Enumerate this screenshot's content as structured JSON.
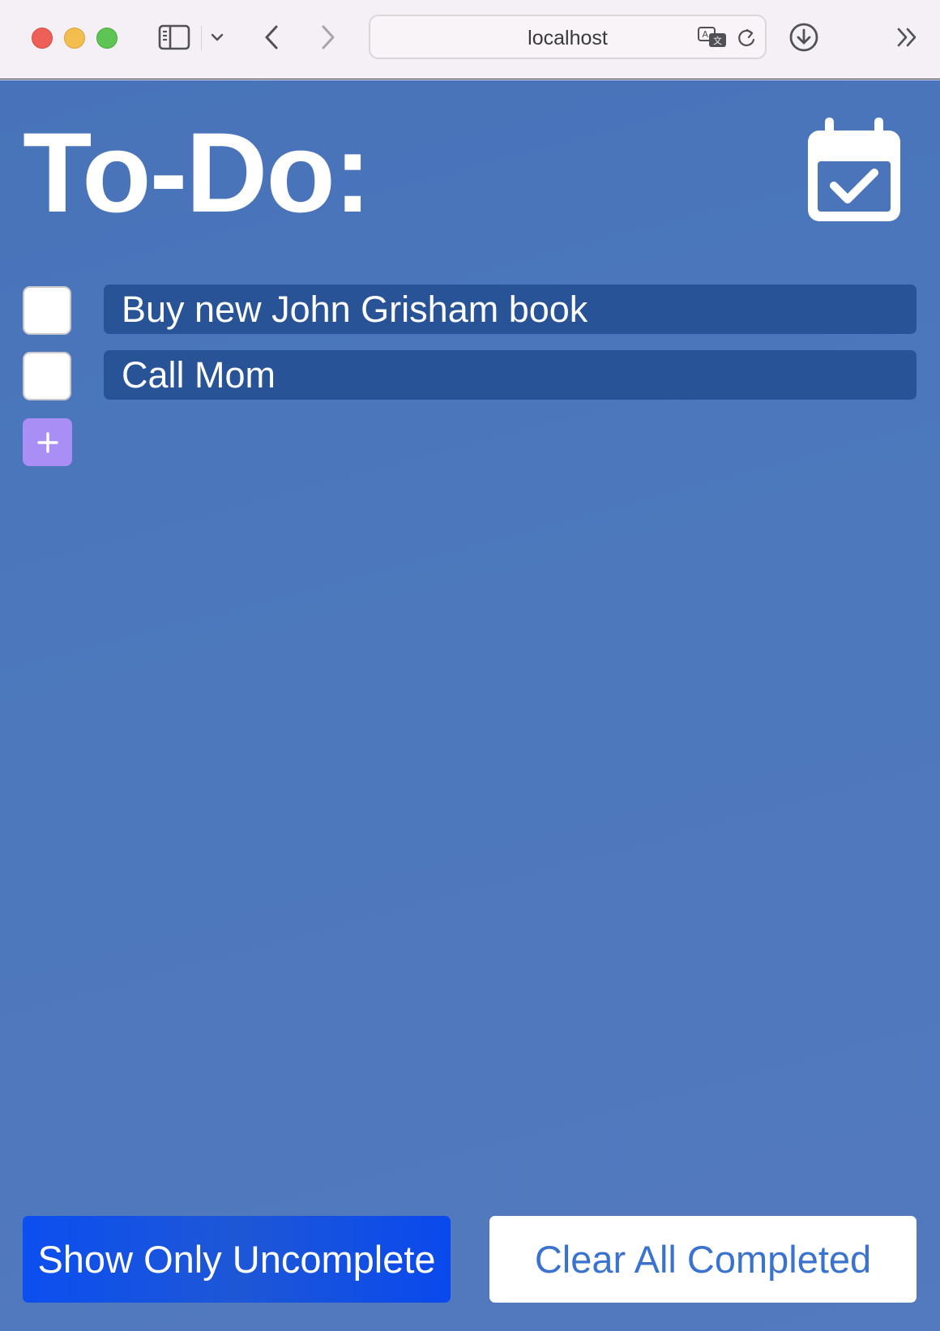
{
  "browser": {
    "address": "localhost"
  },
  "app": {
    "title": "To-Do:",
    "add_label": "+",
    "todos": [
      {
        "text": "Buy new John Grisham book",
        "checked": false
      },
      {
        "text": "Call Mom",
        "checked": false
      }
    ],
    "buttons": {
      "show_uncomplete": "Show Only Uncomplete",
      "clear_completed": "Clear All Completed"
    }
  },
  "icons": {
    "calendar": "calendar-check-icon",
    "add": "plus-icon"
  },
  "colors": {
    "page_background": "#4a75bb",
    "todo_text_background": "#285397",
    "add_button": "#a98ef5",
    "primary_button": "#0c4ef0",
    "secondary_button_text": "#3a73cf"
  }
}
